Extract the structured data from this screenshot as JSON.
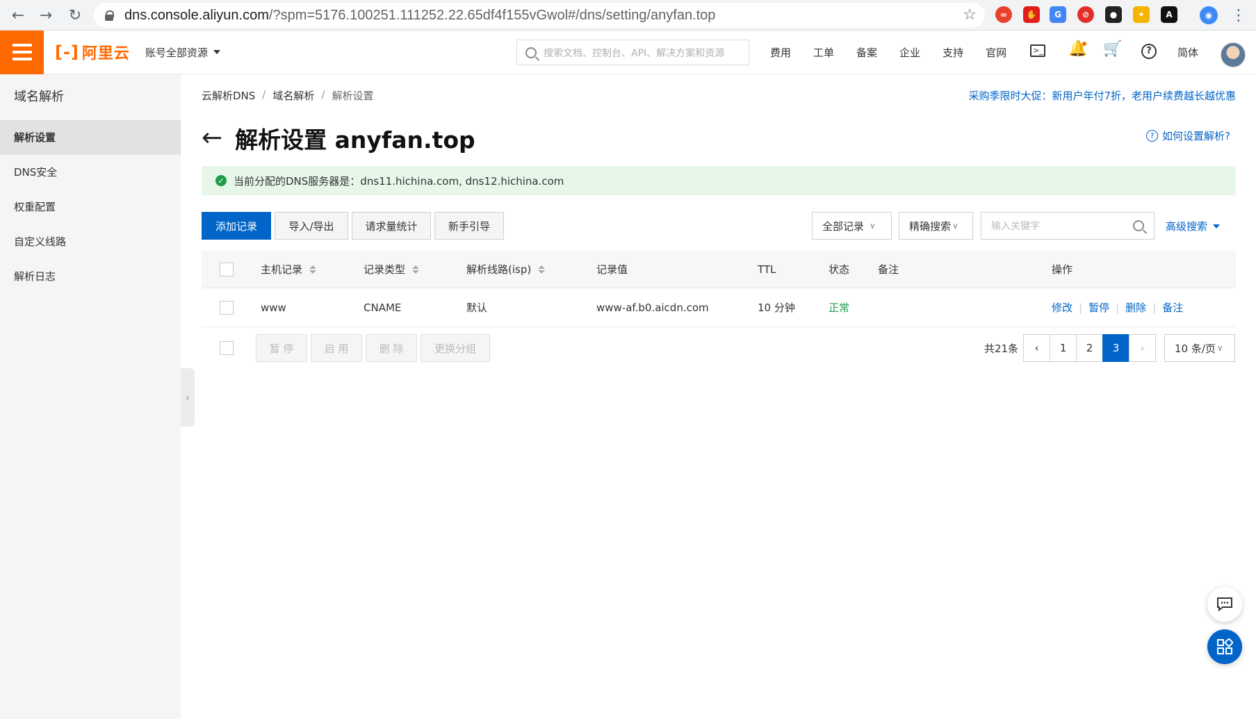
{
  "browser": {
    "url_host": "dns.console.aliyun.com",
    "url_rest": "/?spm=5176.100251.111252.22.65df4f155vGwol#/dns/setting/anyfan.top",
    "ext_last": "A"
  },
  "topbar": {
    "logo_text": "阿里云",
    "account_label": "账号全部资源",
    "search_placeholder": "搜索文档、控制台、API、解决方案和资源",
    "nav": [
      "费用",
      "工单",
      "备案",
      "企业",
      "支持",
      "官网"
    ],
    "lang": "简体"
  },
  "sidebar": {
    "title": "域名解析",
    "items": [
      {
        "label": "解析设置",
        "active": true
      },
      {
        "label": "DNS安全"
      },
      {
        "label": "权重配置"
      },
      {
        "label": "自定义线路"
      },
      {
        "label": "解析日志"
      }
    ]
  },
  "breadcrumb": [
    "云解析DNS",
    "域名解析",
    "解析设置"
  ],
  "promo": "采购季限时大促：新用户年付7折，老用户续费越长越优惠",
  "page_title": "解析设置 anyfan.top",
  "help_link": "如何设置解析?",
  "alert_text": "当前分配的DNS服务器是：dns11.hichina.com, dns12.hichina.com",
  "toolbar": {
    "add": "添加记录",
    "import_export": "导入/导出",
    "stats": "请求量统计",
    "guide": "新手引导",
    "filter_all": "全部记录",
    "exact_search": "精确搜索",
    "keyword_placeholder": "输入关键字",
    "advanced": "高级搜索"
  },
  "table": {
    "headers": [
      "主机记录",
      "记录类型",
      "解析线路(isp)",
      "记录值",
      "TTL",
      "状态",
      "备注",
      "操作"
    ],
    "rows": [
      {
        "host": "www",
        "type": "CNAME",
        "line": "默认",
        "value": "www-af.b0.aicdn.com",
        "ttl": "10 分钟",
        "status": "正常",
        "remark": "",
        "ops": [
          "修改",
          "暂停",
          "删除",
          "备注"
        ]
      }
    ]
  },
  "footer": {
    "bulk": [
      "暂 停",
      "启 用",
      "删 除",
      "更换分组"
    ],
    "total": "共21条",
    "pages": [
      "1",
      "2",
      "3"
    ],
    "current_page": "3",
    "page_size": "10 条/页"
  },
  "colors": {
    "brand": "#ff6a00",
    "primary": "#0064c8",
    "success": "#1e9d4b"
  }
}
